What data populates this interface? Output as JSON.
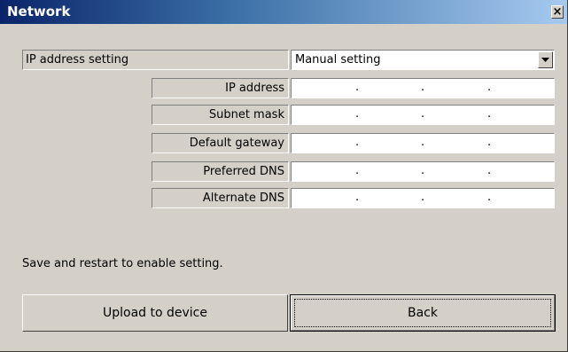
{
  "window": {
    "title": "Network",
    "close_label": "×"
  },
  "ip_setting": {
    "label": "IP address setting",
    "selected": "Manual setting"
  },
  "fields": [
    {
      "label": "IP address",
      "value": ".      .      ."
    },
    {
      "label": "Subnet mask",
      "value": ".      .      ."
    },
    {
      "label": "Default gateway",
      "value": ".      .      ."
    },
    {
      "label": "Preferred DNS",
      "value": ".      .      ."
    },
    {
      "label": "Alternate DNS",
      "value": ".      .      ."
    }
  ],
  "status_text": "Save and restart to enable setting.",
  "buttons": {
    "upload_label": "Upload to device",
    "back_label": "Back"
  }
}
